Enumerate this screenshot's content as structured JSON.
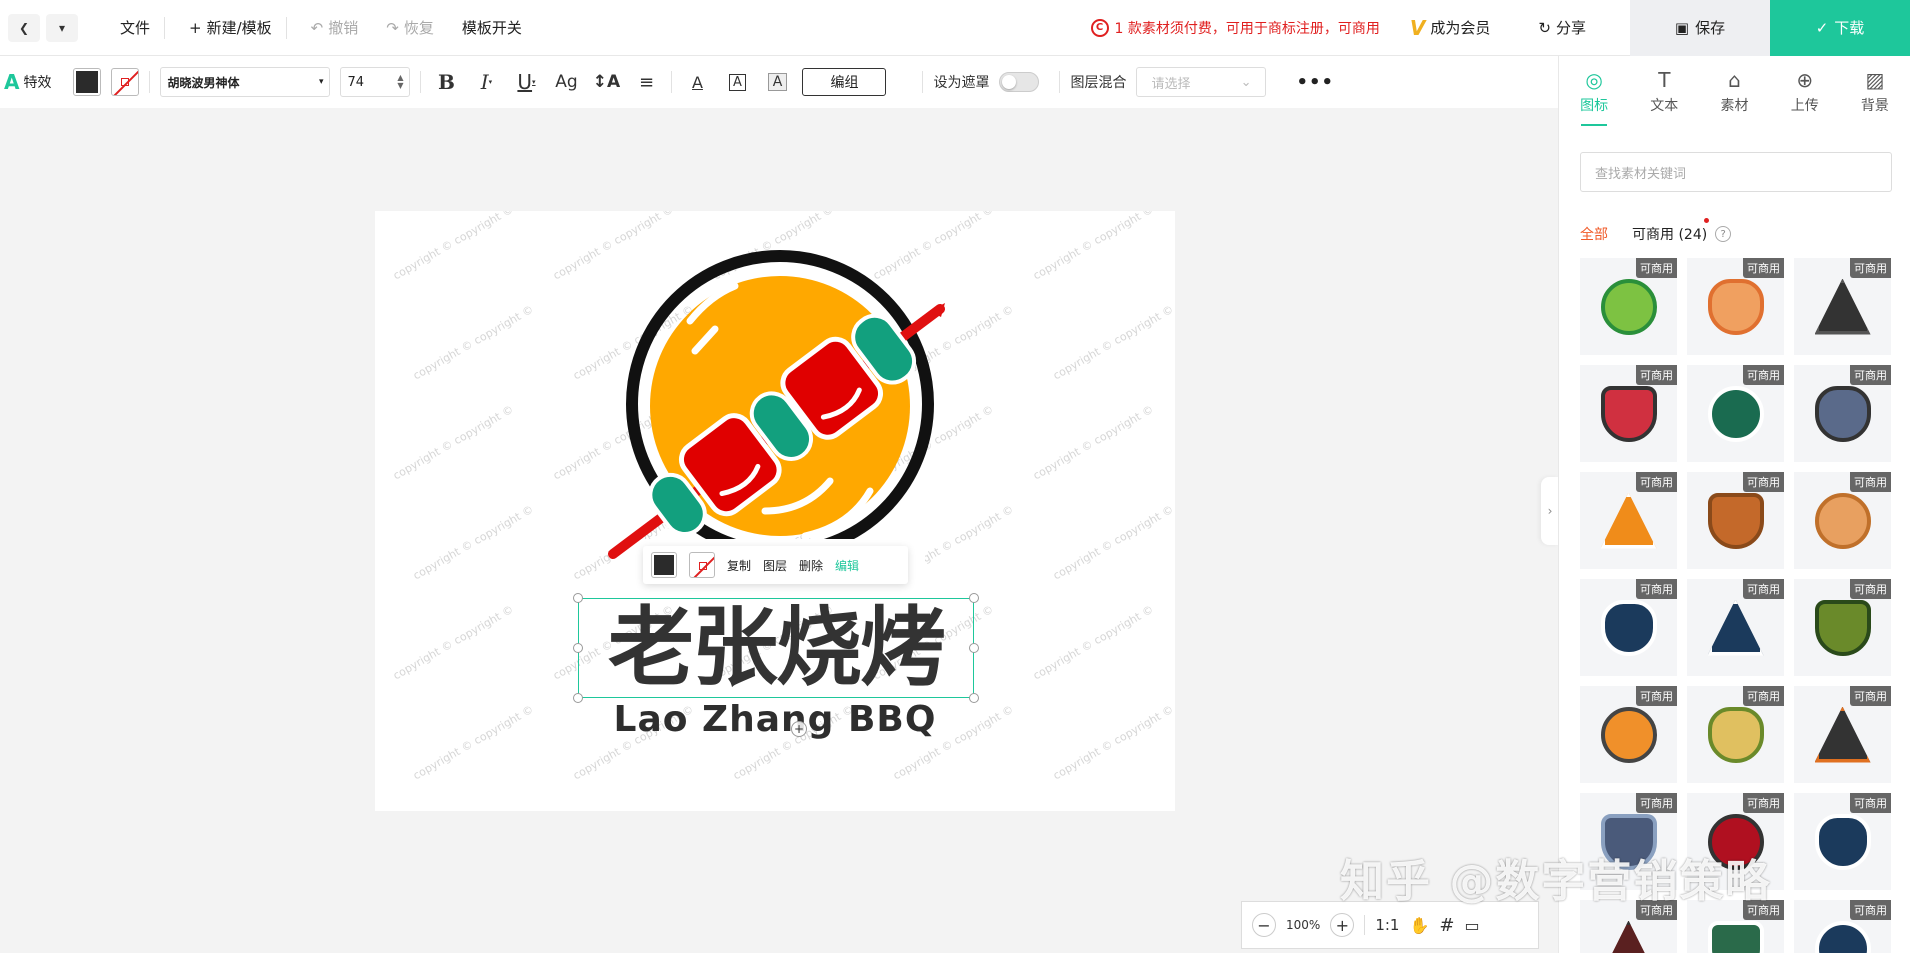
{
  "topbar": {
    "back_icon": "chevron-left-icon",
    "dropdown_icon": "caret-down-icon",
    "file": "文件",
    "new_template": "新建/模板",
    "undo": "撤销",
    "redo": "恢复",
    "template_switch": "模板开关",
    "notice": "1 款素材须付费，可用于商标注册，可商用",
    "vip": "成为会员",
    "share": "分享",
    "save": "保存",
    "download": "下载",
    "accent": "#1ec79b",
    "warning_color": "#e02020"
  },
  "props": {
    "effects": "特效",
    "font": "胡晓波男神体",
    "size": "74",
    "bold": "B",
    "italic": "I",
    "underline": "U",
    "case": "Ag",
    "spacing": "A",
    "font_color_letter": "A",
    "stroke_letter": "A",
    "bg_letter": "A",
    "group": "编组",
    "mask": "设为遮罩",
    "blend_label": "图层混合",
    "blend_placeholder": "请选择",
    "more": "•••",
    "fill_color": "#2b2b2b"
  },
  "canvas": {
    "title": "老张烧烤",
    "subtitle": "Lao Zhang BBQ",
    "watermark": "copyright © copyright ©",
    "logo_colors": {
      "ring": "#111111",
      "sun": "#ffa800",
      "meat": "#e00000",
      "veg": "#12a07e",
      "stick": "#e01010"
    }
  },
  "context_menu": {
    "copy": "复制",
    "layer": "图层",
    "delete": "删除",
    "edit": "编辑"
  },
  "panel": {
    "tabs": [
      {
        "label": "图标",
        "icon": "target-icon"
      },
      {
        "label": "文本",
        "icon": "text-icon"
      },
      {
        "label": "素材",
        "icon": "shapes-icon"
      },
      {
        "label": "上传",
        "icon": "upload-icon"
      },
      {
        "label": "背景",
        "icon": "stripes-icon"
      }
    ],
    "search_placeholder": "查找素材关键词",
    "filter_all": "全部",
    "filter_commercial": "可商用 (24)",
    "help": "?",
    "badge": "可商用",
    "tiles": [
      "green-star-ball-icon",
      "cat-pirate-icon",
      "samurai-icon",
      "panda-warrior-icon",
      "badminton-star-icon",
      "blue-samurai-icon",
      "baseball-triangle-icon",
      "panda-orange-icon",
      "panda-cowboy-icon",
      "golf-shield-icon",
      "baseball-shield-icon",
      "green-warrior-icon",
      "farmer-icon",
      "farmer-green-icon",
      "panda-pirate-icon",
      "wizard-hat-icon",
      "red-warrior-icon",
      "badminton-shield-icon",
      "witch-icon",
      "green-hat-icon",
      "blue-mask-icon"
    ]
  },
  "zoom": {
    "minus": "−",
    "level": "100%",
    "plus": "+",
    "ratio": "1:1"
  },
  "site_watermark": "知乎 @数字营销策略"
}
